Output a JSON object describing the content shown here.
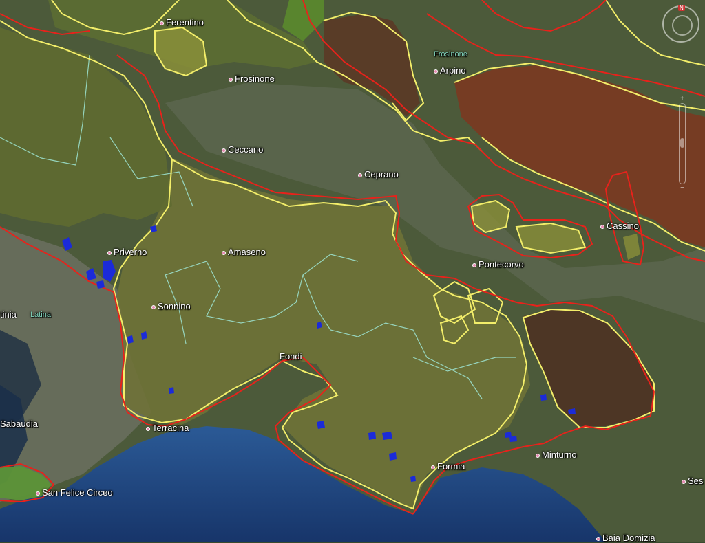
{
  "map": {
    "base": "satellite",
    "colors": {
      "boundary_red": "#e8221b",
      "boundary_yellow": "#f3ee6a",
      "boundary_cyan": "#9fe7d6",
      "highlight_brown": "#7a3a22",
      "highlight_olive": "#8a8f3a",
      "sea": "#1d3f7a"
    },
    "places": {
      "ferentino": "Ferentino",
      "frosinone": "Frosinone",
      "frosinone_region": "Frosinone",
      "arpino": "Arpino",
      "ceccano": "Ceccano",
      "ceprano": "Ceprano",
      "cassino": "Cassino",
      "amaseno": "Amaseno",
      "priverno": "Priverno",
      "pontecorvo": "Pontecorvo",
      "latina_partial": "tinia",
      "latina_region": "Latina",
      "sonnino": "Sonnino",
      "fondi": "Fondi",
      "sabaudia": "Sabaudia",
      "terracina": "Terracina",
      "minturno": "Minturno",
      "formia": "Formia",
      "san_felice": "San Felice Circeo",
      "sessa_partial": "Ses",
      "baia_domizia_partial": "Baia Domizia"
    },
    "controls": {
      "north_label": "N",
      "zoom_in": "+",
      "zoom_out": "−"
    }
  }
}
